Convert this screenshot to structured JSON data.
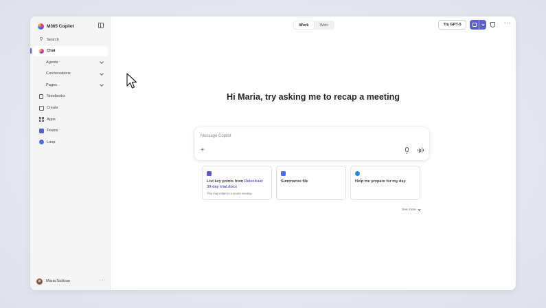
{
  "app": {
    "title": "M365 Copilot"
  },
  "sidebar": {
    "search_label": "Search",
    "items": [
      {
        "label": "Chat",
        "icon": "copilot-chat-icon",
        "active": true
      },
      {
        "label": "Agents",
        "icon": "",
        "expandable": true
      },
      {
        "label": "Conversations",
        "icon": "",
        "expandable": true
      },
      {
        "label": "Pages",
        "icon": "",
        "expandable": true
      },
      {
        "label": "Notebooks",
        "icon": "notebook-icon"
      },
      {
        "label": "Create",
        "icon": "create-icon"
      },
      {
        "label": "Apps",
        "icon": "apps-icon"
      },
      {
        "label": "Teams",
        "icon": "teams-icon"
      },
      {
        "label": "Loop",
        "icon": "loop-icon"
      }
    ],
    "user": {
      "name": "Maria Sullivan"
    }
  },
  "header": {
    "modes": [
      {
        "label": "Work",
        "selected": true
      },
      {
        "label": "Web",
        "selected": false
      }
    ],
    "try_button": "Try GPT-5"
  },
  "main": {
    "greeting": "Hi Maria, try asking me to recap a meeting",
    "composer": {
      "placeholder": "Message Copilot"
    },
    "suggestions": [
      {
        "title_prefix": "List key points from ",
        "title_highlight": "Relecloud 30-day trial.docx",
        "subtitle": "This may relate to a recent meeting",
        "icon_color": "#5b5fc7"
      },
      {
        "title_prefix": "Summarize file",
        "title_highlight": "",
        "subtitle": "",
        "icon_color": "#4f6bed"
      },
      {
        "title_prefix": "Help me prepare for my day",
        "title_highlight": "",
        "subtitle": "",
        "icon_color": "#2b88d8"
      }
    ],
    "see_more": "See more"
  },
  "colors": {
    "accent": "#5b5fc7",
    "sidebar_bg": "#f5f5f5"
  }
}
